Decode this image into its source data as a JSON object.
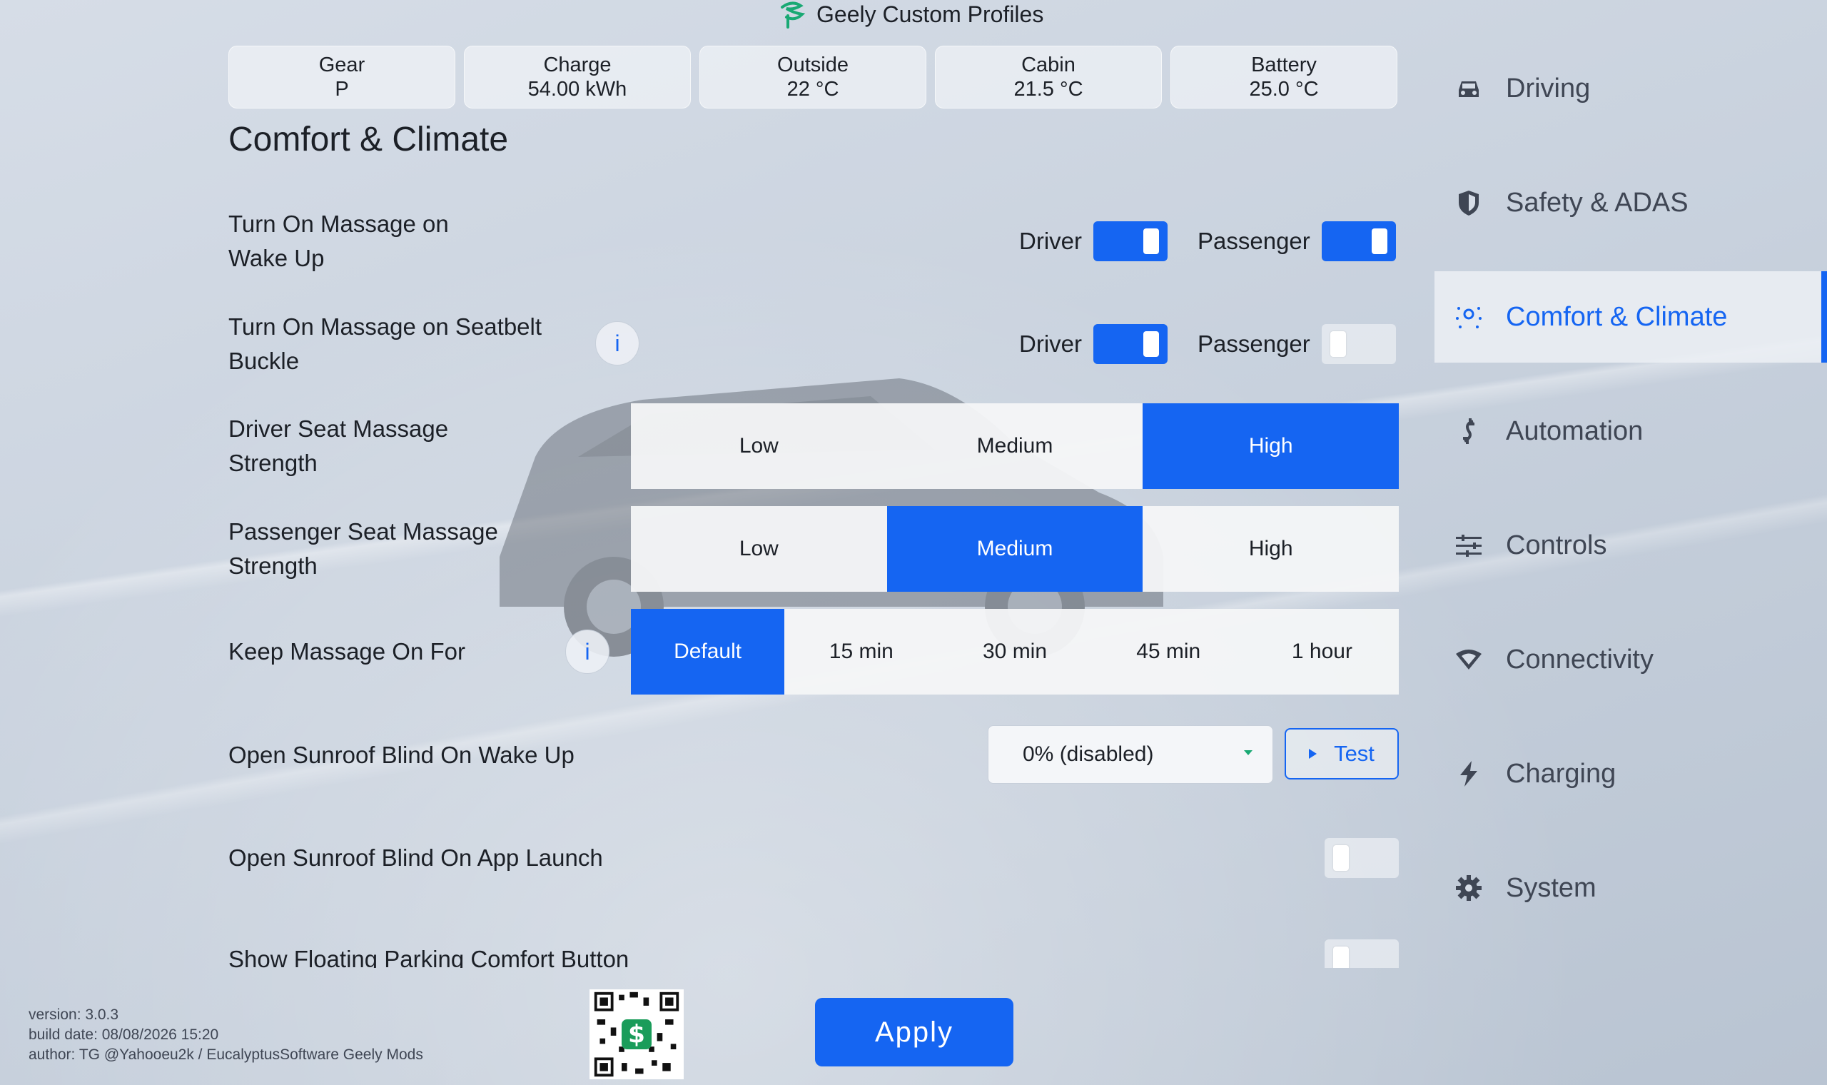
{
  "app": {
    "title": "Geely Custom Profiles",
    "logo_icon": "geely-logo-icon"
  },
  "stats": [
    {
      "label": "Gear",
      "value": "P"
    },
    {
      "label": "Charge",
      "value": "54.00 kWh"
    },
    {
      "label": "Outside",
      "value": "22 °C"
    },
    {
      "label": "Cabin",
      "value": "21.5 °C"
    },
    {
      "label": "Battery",
      "value": "25.0 °C"
    }
  ],
  "page": {
    "title": "Comfort & Climate"
  },
  "settings": {
    "massage_wake": {
      "line1": "Turn On Massage on",
      "line2": "Wake Up",
      "driver_label": "Driver",
      "driver_on": true,
      "passenger_label": "Passenger",
      "passenger_on": true
    },
    "massage_buckle": {
      "line1": "Turn On Massage on Seatbelt",
      "line2": "Buckle",
      "info": "i",
      "driver_label": "Driver",
      "driver_on": true,
      "passenger_label": "Passenger",
      "passenger_on": false
    },
    "driver_strength": {
      "line1": "Driver Seat Massage",
      "line2": "Strength",
      "options": [
        "Low",
        "Medium",
        "High"
      ],
      "selected": "High"
    },
    "passenger_strength": {
      "line1": "Passenger Seat Massage",
      "line2": "Strength",
      "options": [
        "Low",
        "Medium",
        "High"
      ],
      "selected": "Medium"
    },
    "keep_massage": {
      "label": "Keep Massage On For",
      "info": "i",
      "options": [
        "Default",
        "15 min",
        "30 min",
        "45 min",
        "1 hour"
      ],
      "selected": "Default"
    },
    "sunroof_wake": {
      "label": "Open Sunroof Blind On Wake Up",
      "dropdown_value": "0% (disabled)",
      "test_label": "Test"
    },
    "sunroof_launch": {
      "label": "Open Sunroof Blind On App Launch",
      "on": false
    },
    "floating_button": {
      "label": "Show Floating Parking Comfort Button",
      "on": false
    }
  },
  "nav": {
    "items": [
      {
        "label": "Driving",
        "icon": "car-icon"
      },
      {
        "label": "Safety & ADAS",
        "icon": "shield-icon"
      },
      {
        "label": "Comfort & Climate",
        "icon": "climate-icon"
      },
      {
        "label": "Automation",
        "icon": "automation-icon"
      },
      {
        "label": "Controls",
        "icon": "sliders-icon"
      },
      {
        "label": "Connectivity",
        "icon": "wifi-icon"
      },
      {
        "label": "Charging",
        "icon": "bolt-icon"
      },
      {
        "label": "System",
        "icon": "gear-icon"
      }
    ],
    "active": "Comfort & Climate"
  },
  "footer": {
    "version": "version: 3.0.3",
    "build_date": "build date: 08/08/2026 15:20",
    "author": "author: TG @Yahooeu2k / EucalyptusSoftware Geely Mods",
    "apply_label": "Apply"
  },
  "colors": {
    "accent": "#1565f2",
    "logo_green": "#19a974"
  }
}
